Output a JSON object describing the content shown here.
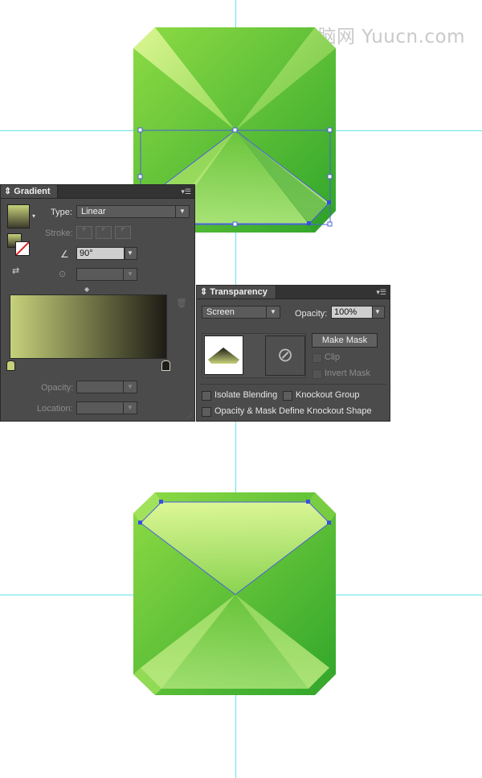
{
  "watermark": "电脑网 Yuucn.com",
  "gradient_panel": {
    "title": "Gradient",
    "type_label": "Type:",
    "type_value": "Linear",
    "stroke_label": "Stroke:",
    "angle_value": "90°",
    "opacity_label": "Opacity:",
    "location_label": "Location:",
    "gradient_start_color": "#c6d17a",
    "gradient_end_color": "#1e1c15"
  },
  "transparency_panel": {
    "title": "Transparency",
    "blend_mode": "Screen",
    "opacity_label": "Opacity:",
    "opacity_value": "100%",
    "make_mask": "Make Mask",
    "clip": "Clip",
    "invert_mask": "Invert Mask",
    "isolate_blending": "Isolate Blending",
    "knockout_group": "Knockout Group",
    "opacity_mask_define": "Opacity & Mask Define Knockout Shape"
  },
  "colors": {
    "guide": "#64e5ea",
    "gem_green": "#4cbd2e",
    "panel_bg": "#4b4b4b"
  }
}
